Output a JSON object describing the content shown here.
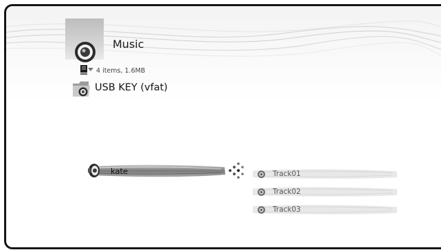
{
  "header": {
    "title": "Music",
    "icon": "speaker-icon"
  },
  "info": {
    "text": "4 items, 1.6MB",
    "icon": "storage-info-icon"
  },
  "folder": {
    "label": "USB KEY (vfat)",
    "icon": "folder-speaker-icon"
  },
  "current": {
    "label": "kate",
    "icon": "speaker-icon",
    "expand_icon": "expand-arrow-icon"
  },
  "tracks": [
    {
      "label": "Track01",
      "icon": "audio-file-icon"
    },
    {
      "label": "Track02",
      "icon": "audio-file-icon"
    },
    {
      "label": "Track03",
      "icon": "audio-file-icon"
    }
  ],
  "colors": {
    "frame": "#141414",
    "highlight": "#8a8a8a",
    "track_bg": "#e6e6e6"
  }
}
